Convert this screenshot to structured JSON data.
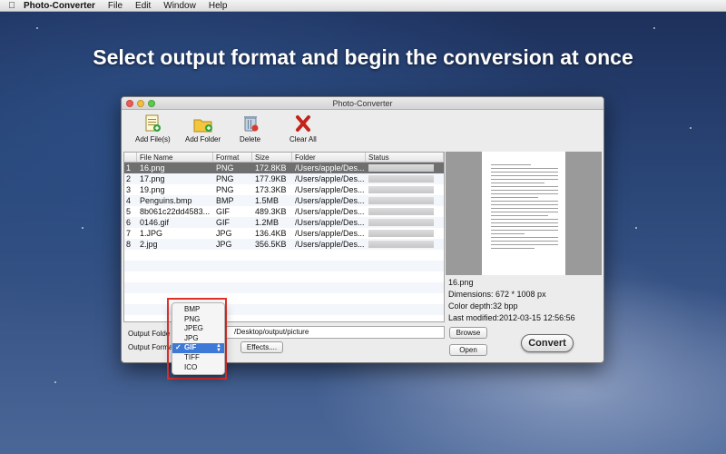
{
  "menubar": {
    "app_name": "Photo-Converter",
    "items": [
      "File",
      "Edit",
      "Window",
      "Help"
    ]
  },
  "headline": "Select output format and begin the conversion at once",
  "window": {
    "title": "Photo-Converter",
    "toolbar": {
      "add_files": "Add File(s)",
      "add_folder": "Add Folder",
      "delete": "Delete",
      "clear_all": "Clear All"
    },
    "table": {
      "columns": [
        "File Name",
        "Format",
        "Size",
        "Folder",
        "Status"
      ],
      "rows": [
        {
          "num": "1",
          "name": "16.png",
          "format": "PNG",
          "size": "172.8KB",
          "folder": "/Users/apple/Des..."
        },
        {
          "num": "2",
          "name": "17.png",
          "format": "PNG",
          "size": "177.9KB",
          "folder": "/Users/apple/Des..."
        },
        {
          "num": "3",
          "name": "19.png",
          "format": "PNG",
          "size": "173.3KB",
          "folder": "/Users/apple/Des..."
        },
        {
          "num": "4",
          "name": "Penguins.bmp",
          "format": "BMP",
          "size": "1.5MB",
          "folder": "/Users/apple/Des..."
        },
        {
          "num": "5",
          "name": "8b061c22dd4583...",
          "format": "GIF",
          "size": "489.3KB",
          "folder": "/Users/apple/Des..."
        },
        {
          "num": "6",
          "name": "0146.gif",
          "format": "GIF",
          "size": "1.2MB",
          "folder": "/Users/apple/Des..."
        },
        {
          "num": "7",
          "name": "1.JPG",
          "format": "JPG",
          "size": "136.4KB",
          "folder": "/Users/apple/Des..."
        },
        {
          "num": "8",
          "name": "2.jpg",
          "format": "JPG",
          "size": "356.5KB",
          "folder": "/Users/apple/Des..."
        }
      ]
    },
    "preview_info": {
      "filename": "16.png",
      "dimensions": "Dimensions: 672 * 1008 px",
      "color_depth": "Color depth:32 bpp",
      "last_modified": "Last modified:2012-03-15 12:56:56"
    },
    "output_folder_label": "Output Folde",
    "output_folder_value": "/Desktop/output/picture",
    "output_format_label": "Output Format",
    "buttons": {
      "browse": "Browse",
      "open": "Open",
      "effects": "Effects....",
      "convert": "Convert"
    },
    "format_options": [
      "BMP",
      "PNG",
      "JPEG",
      "JPG",
      "GIF",
      "TIFF",
      "ICO"
    ],
    "selected_format": "GIF",
    "check_mark": "✓"
  }
}
